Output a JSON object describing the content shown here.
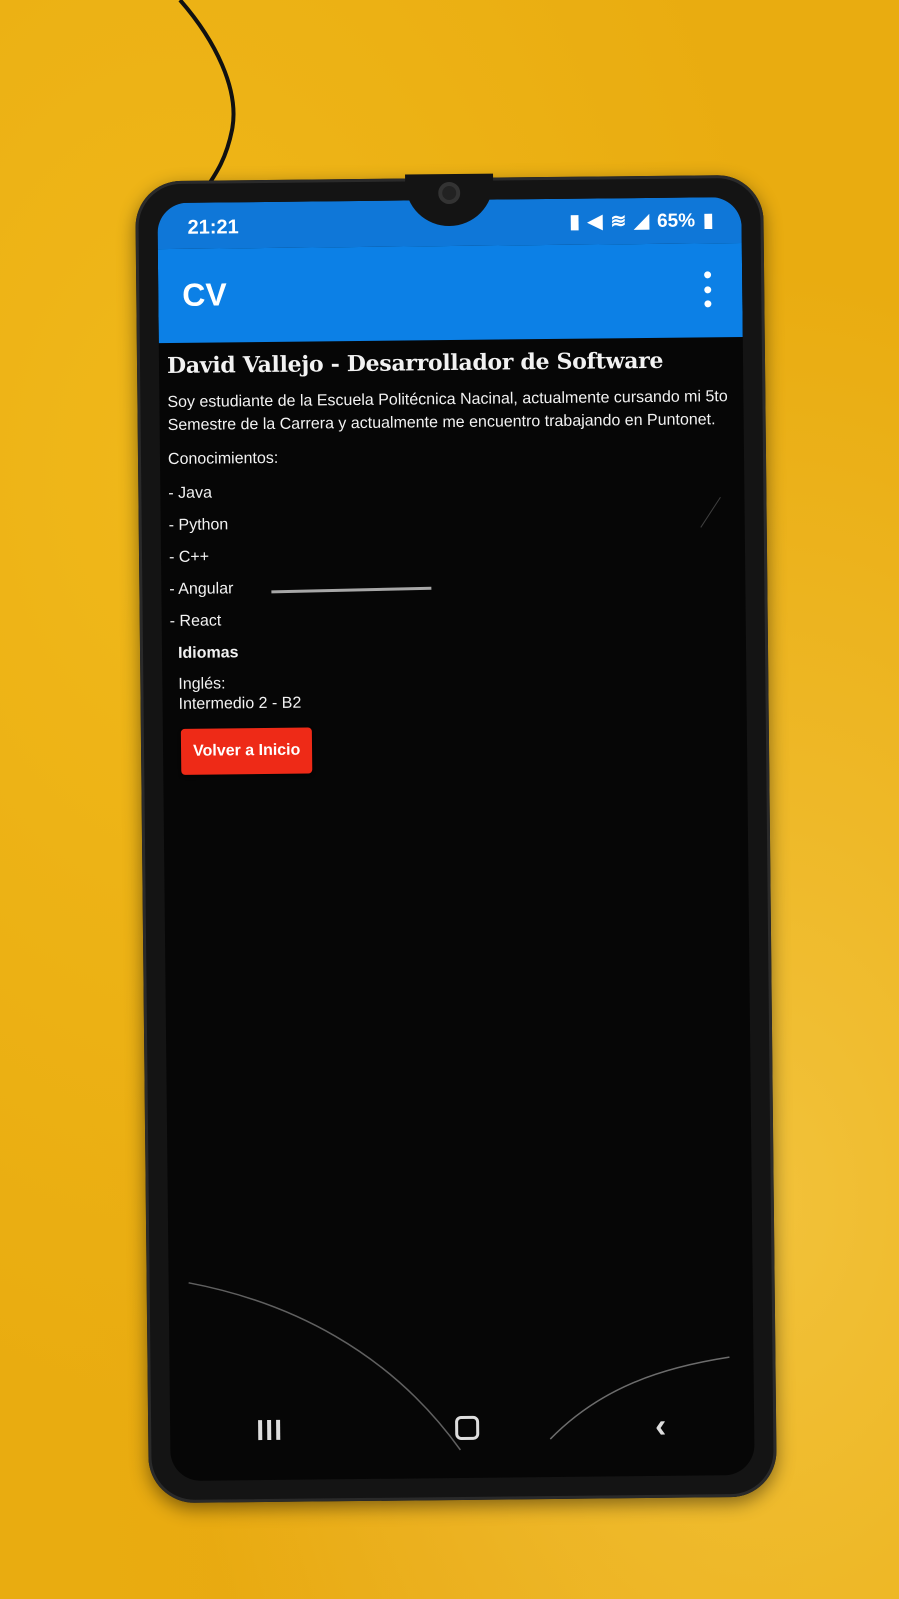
{
  "status_bar": {
    "time": "21:21",
    "battery": "65%",
    "icons": [
      "battery-saver-icon",
      "mute-icon",
      "wifi-icon",
      "signal-icon",
      "battery-icon"
    ]
  },
  "app_bar": {
    "title": "CV",
    "menu_icon": "overflow-menu-icon"
  },
  "content": {
    "heading": "David Vallejo - Desarrollador de Software",
    "description": "Soy estudiante de la Escuela Politécnica Nacinal, actualmente cursando mi 5to Semestre de la Carrera y actualmente me encuentro trabajando en Puntonet.",
    "skills_label": "Conocimientos:",
    "skills": [
      "- Java",
      "- Python",
      "- C++",
      "- Angular",
      "- React"
    ],
    "languages_label": "Idiomas",
    "language_name": "Inglés:",
    "language_level": "Intermedio 2 - B2",
    "back_button": "Volver a Inicio"
  },
  "colors": {
    "app_bar": "#0c80e6",
    "button": "#ee2a17",
    "background": "#060606"
  }
}
